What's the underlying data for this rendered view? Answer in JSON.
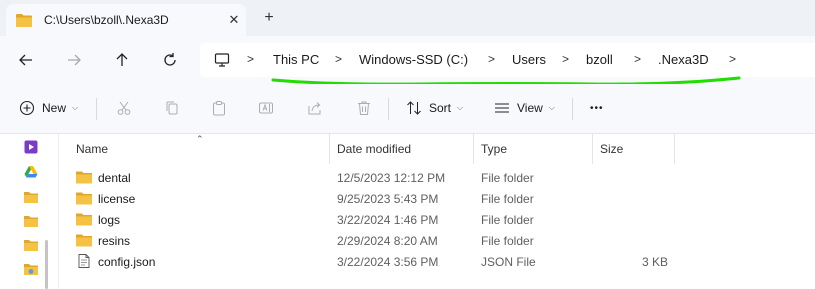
{
  "window": {
    "tab_title": "C:\\Users\\bzoll\\.Nexa3D",
    "close_glyph": "✕",
    "new_tab_glyph": "+"
  },
  "nav": {
    "back_icon": "arrow-left-icon",
    "forward_icon": "arrow-right-icon",
    "up_icon": "arrow-up-icon",
    "refresh_icon": "refresh-icon",
    "breadcrumbs": [
      "This PC",
      "Windows-SSD (C:)",
      "Users",
      "bzoll",
      ".Nexa3D"
    ],
    "annotation_color": "#22dd00"
  },
  "toolbar": {
    "new_label": "New",
    "sort_label": "Sort",
    "view_label": "View",
    "more_glyph": "•••",
    "icons": [
      "plus-circle-icon",
      "cut-icon",
      "copy-icon",
      "paste-icon",
      "rename-icon",
      "share-icon",
      "delete-icon",
      "sort-icon",
      "view-icon",
      "more-icon"
    ]
  },
  "columns": {
    "name": "Name",
    "date_modified": "Date modified",
    "type": "Type",
    "size": "Size"
  },
  "files": [
    {
      "name": "dental",
      "date": "12/5/2023 12:12 PM",
      "type": "File folder",
      "size": "",
      "icon": "folder-icon"
    },
    {
      "name": "license",
      "date": "9/25/2023 5:43 PM",
      "type": "File folder",
      "size": "",
      "icon": "folder-icon"
    },
    {
      "name": "logs",
      "date": "3/22/2024 1:46 PM",
      "type": "File folder",
      "size": "",
      "icon": "folder-icon"
    },
    {
      "name": "resins",
      "date": "2/29/2024 8:20 AM",
      "type": "File folder",
      "size": "",
      "icon": "folder-icon"
    },
    {
      "name": "config.json",
      "date": "3/22/2024 3:56 PM",
      "type": "JSON File",
      "size": "3 KB",
      "icon": "file-icon"
    }
  ],
  "colors": {
    "folder": "#f6c244",
    "folder_dark": "#e0a82a",
    "accent": "#7a3cc7"
  }
}
